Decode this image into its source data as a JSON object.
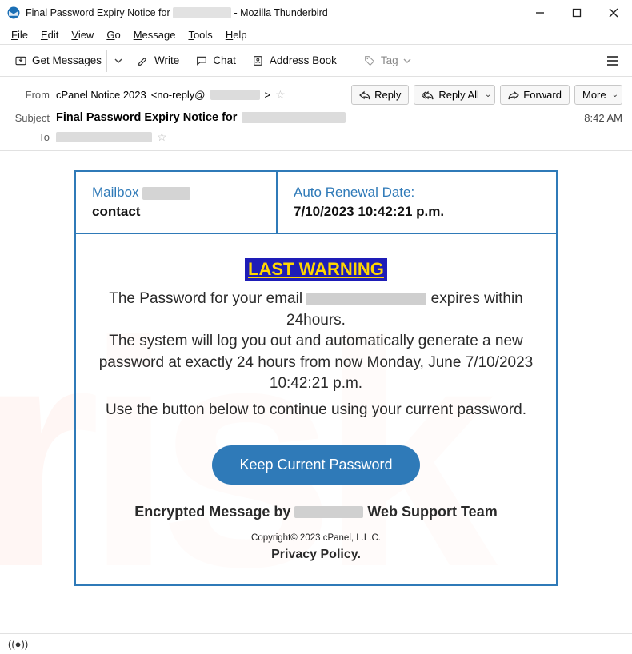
{
  "window": {
    "title_prefix": "Final Password Expiry Notice for ",
    "title_redacted": "███████████████",
    "title_suffix": " - Mozilla Thunderbird"
  },
  "menubar": [
    "File",
    "Edit",
    "View",
    "Go",
    "Message",
    "Tools",
    "Help"
  ],
  "toolbar": {
    "get_messages": "Get Messages",
    "write": "Write",
    "chat": "Chat",
    "address_book": "Address Book",
    "tag": "Tag"
  },
  "message_header": {
    "from_label": "From",
    "from_name": "cPanel Notice 2023",
    "from_address_prefix": "<no-reply@",
    "from_address_redacted": "██████",
    "from_address_suffix": " >",
    "reply": "Reply",
    "reply_all": "Reply All",
    "forward": "Forward",
    "more": "More",
    "subject_label": "Subject",
    "subject_text": "Final Password Expiry Notice for ",
    "subject_redacted": "████████████",
    "time": "8:42 AM",
    "to_label": "To"
  },
  "email": {
    "mailbox_label": "Mailbox",
    "mailbox_sub": "contact",
    "renewal_label": "Auto Renewal Date:",
    "renewal_value": "7/10/2023 10:42:21 p.m.",
    "last_warning": "LAST WARNING",
    "line1a": "The Password for your email ",
    "line1b": " expires within 24hours.",
    "line2": "The system will log you out and automatically generate a new password at exactly 24 hours from now Monday, June 7/10/2023 10:42:21 p.m.",
    "line3": "Use the button below to continue using your current password.",
    "button": "Keep Current Password",
    "enc_prefix": "Encrypted Message by ",
    "enc_suffix": " Web Support Team",
    "copyright": "Copyright© 2023 cPanel, L.L.C.",
    "privacy": "Privacy Policy."
  },
  "status": {
    "indicator": "((●))"
  }
}
